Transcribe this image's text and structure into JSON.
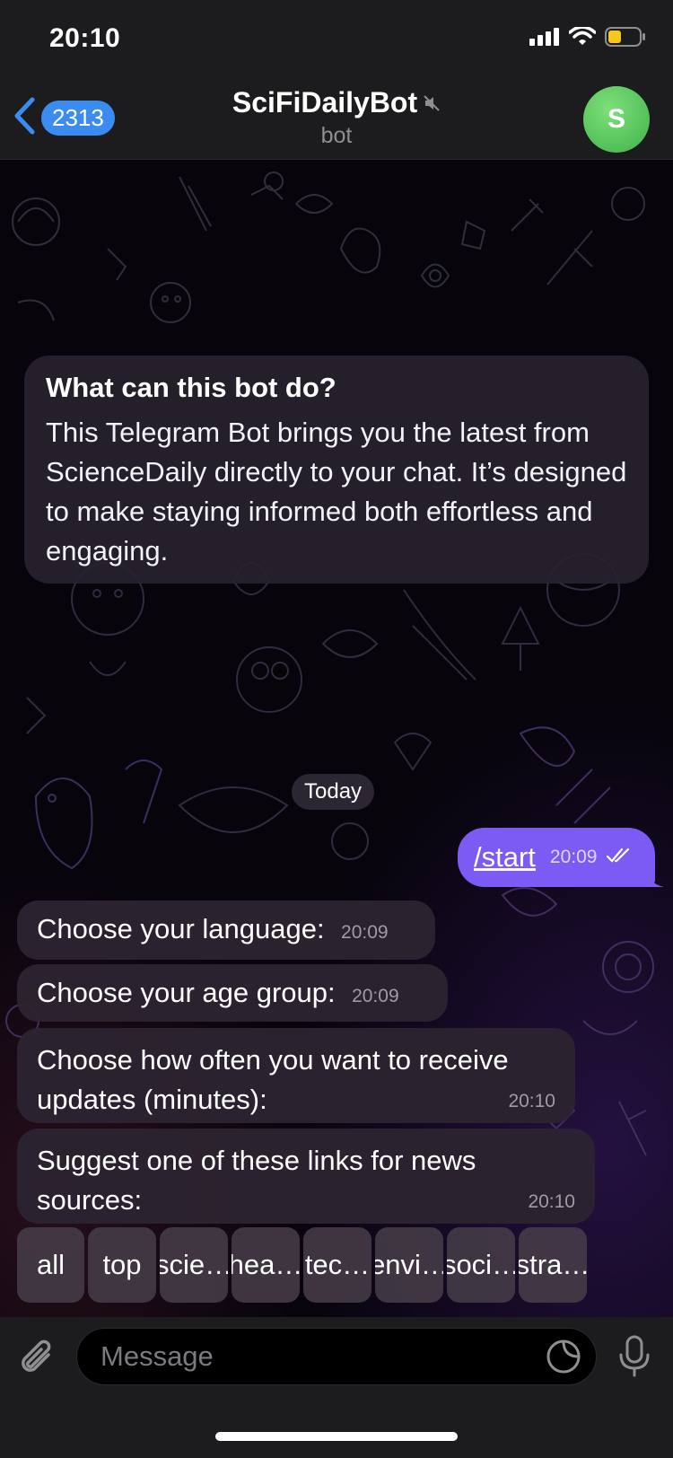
{
  "status": {
    "time": "20:10"
  },
  "header": {
    "back_count": "2313",
    "title": "SciFiDailyBot",
    "subtitle": "bot",
    "avatar_letter": "S"
  },
  "info": {
    "title": "What can this bot do?",
    "body": "This Telegram Bot brings you the latest from ScienceDaily directly to your chat. It’s designed to make staying informed both effortless and engaging."
  },
  "date_divider": "Today",
  "outgoing": {
    "text": "/start",
    "time": "20:09"
  },
  "messages": [
    {
      "text": "Choose your language:",
      "time": "20:09"
    },
    {
      "text": "Choose your age group:",
      "time": "20:09"
    },
    {
      "text": "Choose how often you want to receive updates (minutes):",
      "time": "20:10"
    },
    {
      "text": "Suggest one of these links for news sources:",
      "time": "20:10"
    }
  ],
  "keyboard": [
    "all",
    "top",
    "scie…",
    "hea…",
    "tec…",
    "envi…",
    "soci…",
    "stra…"
  ],
  "input": {
    "placeholder": "Message"
  },
  "colors": {
    "accent": "#3a8cf0",
    "outgoing_bubble": "#7c5bf5",
    "avatar": "#4cbf55"
  }
}
